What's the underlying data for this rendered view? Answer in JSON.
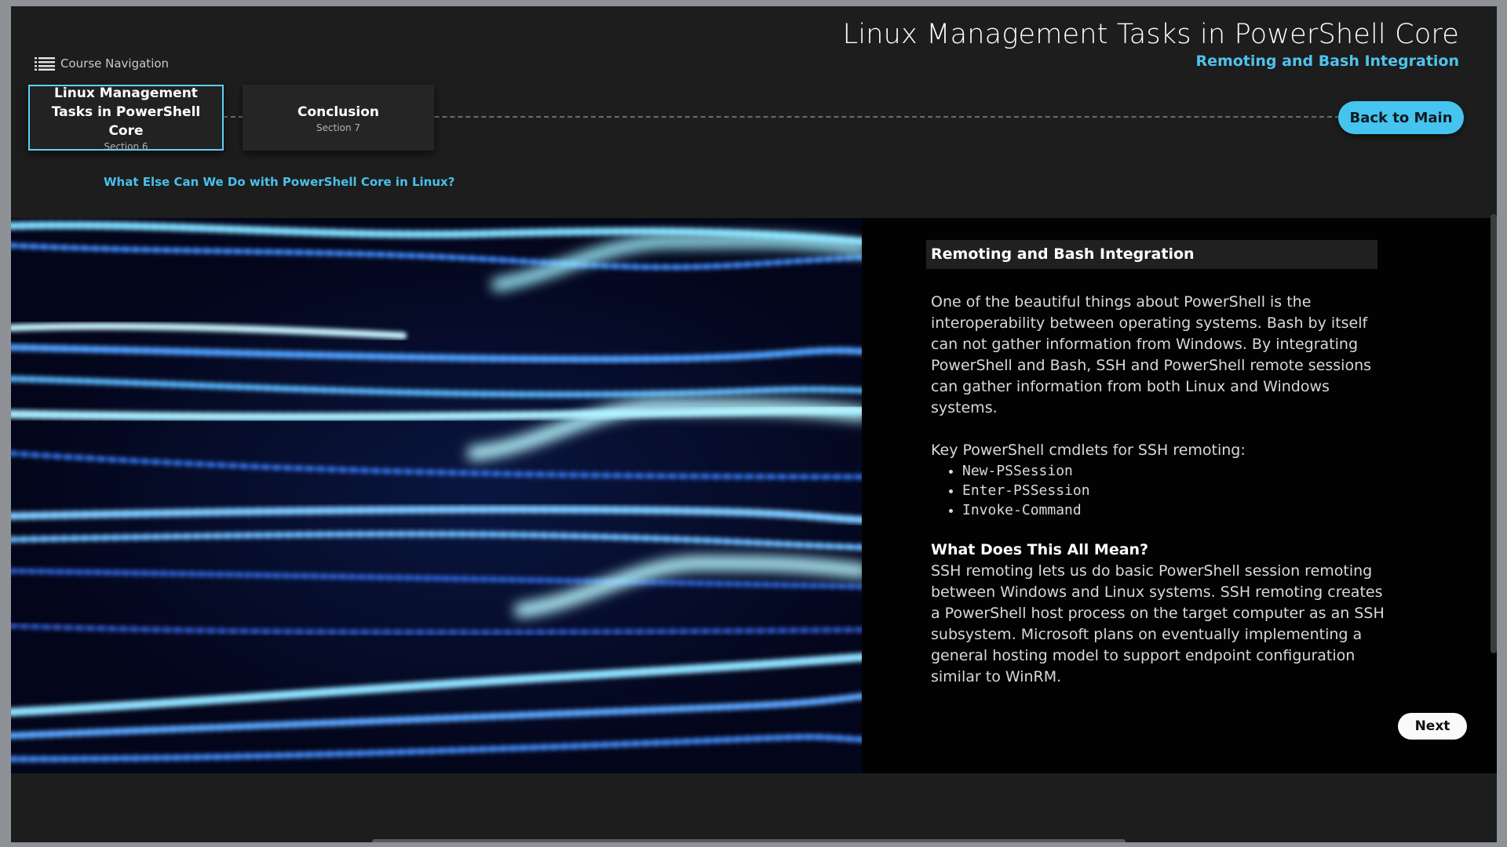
{
  "header": {
    "course_title": "Linux Management Tasks in PowerShell Core",
    "lesson_title": "Remoting and Bash Integration",
    "back_button": "Back to Main"
  },
  "nav": {
    "toggle_label": "Course Navigation",
    "toggle_icon": "list-icon",
    "cards": [
      {
        "title_line1": "Linux Management",
        "title_line2": "Tasks in PowerShell Core",
        "section": "Section 6",
        "active": true
      },
      {
        "title_line1": "Conclusion",
        "title_line2": "",
        "section": "Section 7",
        "active": false
      }
    ],
    "topic_link": "What Else Can We Do with PowerShell Core in Linux?"
  },
  "content": {
    "image_description_icon": "light-streaks-image",
    "heading": "Remoting and Bash Integration",
    "paragraph1": "One of the beautiful things about PowerShell is the interoperability between operating systems. Bash by itself can not gather information from Windows. By integrating PowerShell and Bash, SSH and PowerShell remote sessions can gather information from both Linux and Windows systems.",
    "cmdlets_intro": "Key PowerShell cmdlets for SSH remoting:",
    "cmdlets": [
      "New-PSSession",
      "Enter-PSSession",
      "Invoke-Command"
    ],
    "subheading": "What Does This All Mean?",
    "paragraph2": "SSH remoting lets us do basic PowerShell session remoting between Windows and Linux systems. SSH remoting creates a PowerShell host process on the target computer as an SSH subsystem. Microsoft plans on eventually implementing a general hosting model to support endpoint configuration similar to WinRM.",
    "next_button": "Next"
  },
  "colors": {
    "accent": "#45c4ef",
    "background": "#1d1d1d",
    "content_bg": "#020202"
  }
}
